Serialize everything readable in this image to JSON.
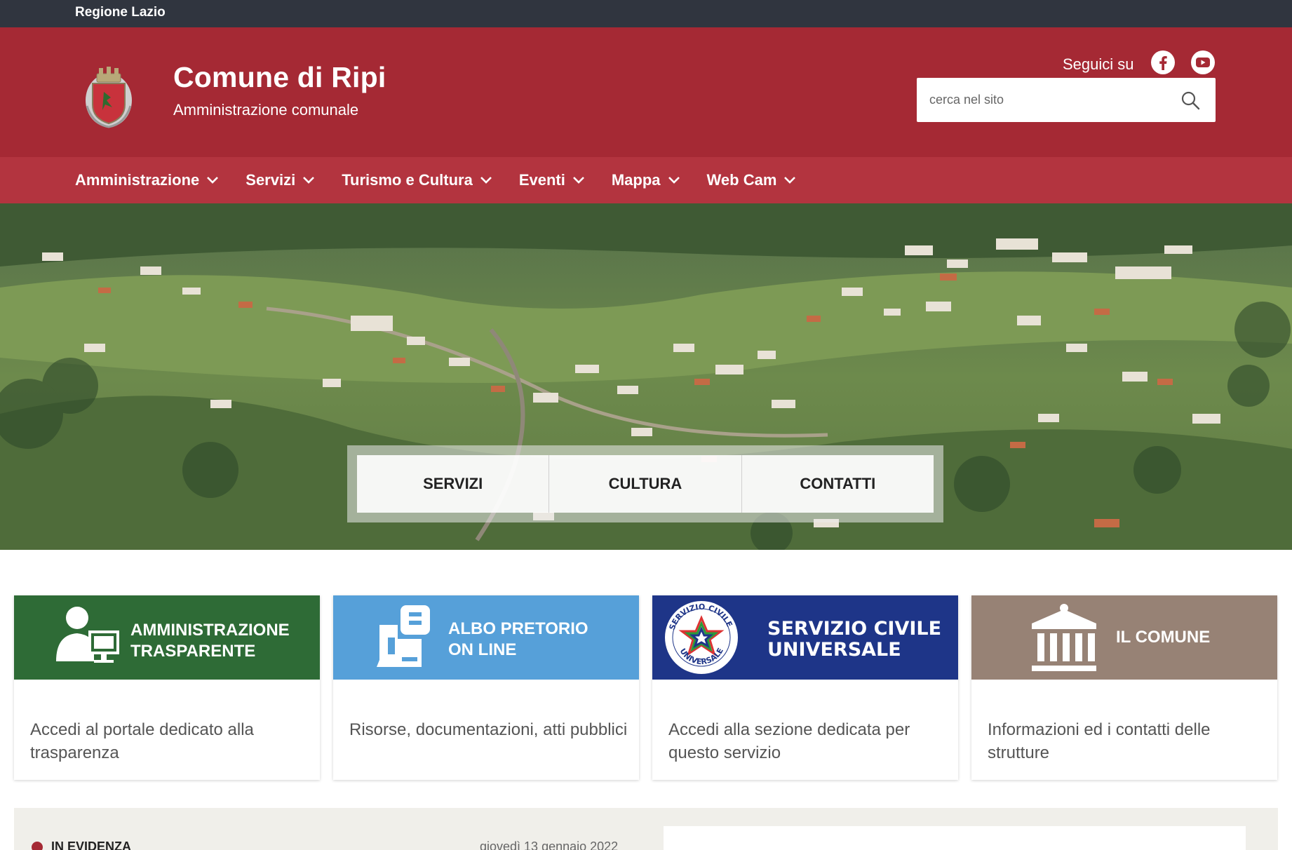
{
  "topbar": {
    "region": "Regione Lazio"
  },
  "header": {
    "title": "Comune di Ripi",
    "subtitle": "Amministrazione comunale",
    "follow_label": "Seguici su",
    "social": [
      {
        "icon": "facebook-icon"
      },
      {
        "icon": "youtube-icon"
      }
    ]
  },
  "search": {
    "placeholder": "cerca nel sito"
  },
  "nav": [
    {
      "label": "Amministrazione"
    },
    {
      "label": "Servizi"
    },
    {
      "label": "Turismo e Cultura"
    },
    {
      "label": "Eventi"
    },
    {
      "label": "Mappa"
    },
    {
      "label": "Web Cam"
    }
  ],
  "quick_links": [
    {
      "label": "SERVIZI"
    },
    {
      "label": "CULTURA"
    },
    {
      "label": "CONTATTI"
    }
  ],
  "cards": [
    {
      "title_line1": "AMMINISTRAZIONE",
      "title_line2": "TRASPARENTE",
      "description": "Accedi al portale dedicato alla trasparenza",
      "color": "#2e6b36",
      "icon": "user-computer-icon"
    },
    {
      "title_line1": "ALBO PRETORIO",
      "title_line2": "ON LINE",
      "description": "Risorse, documentazioni, atti pubblici",
      "color": "#56a0d9",
      "icon": "notice-board-icon"
    },
    {
      "title_line1": "SERVIZIO CIVILE",
      "title_line2": "UNIVERSALE",
      "description": "Accedi alla sezione dedicata per questo servizio",
      "color": "#1e3588",
      "icon": "servizio-civile-logo",
      "logo_text": "SERVIZIO CIVILE UNIVERSALE"
    },
    {
      "title_line1": "IL COMUNE",
      "title_line2": "",
      "description": "Informazioni ed i contatti delle strutture",
      "color": "#978275",
      "icon": "town-hall-icon"
    }
  ],
  "evidenza": {
    "label": "IN EVIDENZA",
    "date": "giovedì 13 gennaio 2022"
  },
  "colors": {
    "topbar": "#30353f",
    "header": "#a52934",
    "nav": "#b3343f"
  }
}
